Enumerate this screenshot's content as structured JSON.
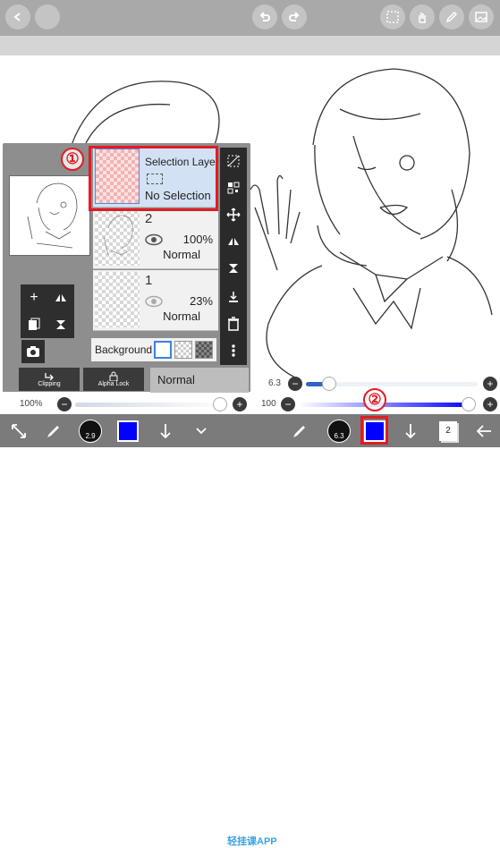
{
  "top_toolbar": {
    "left_icons": [
      "back-icon",
      "blank-icon"
    ],
    "right_icons": [
      "undo-icon",
      "redo-icon",
      "selection-icon",
      "hand-icon",
      "pen-icon",
      "image-icon"
    ]
  },
  "layer_panel": {
    "layers": [
      {
        "name": "Selection Layer",
        "status": "No Selection",
        "selected": true
      },
      {
        "number": "2",
        "opacity": "100%",
        "blend": "Normal",
        "visible": true
      },
      {
        "number": "1",
        "opacity": "23%",
        "blend": "Normal",
        "visible": false
      }
    ],
    "background_label": "Background",
    "clipping_label": "Clipping",
    "alpha_lock_label": "Alpha Lock",
    "blend_mode": "Normal",
    "side_tool_icons": [
      "select-all-icon",
      "qr-icon",
      "move-icon",
      "flip-icon",
      "transform-icon",
      "merge-down-icon",
      "trash-icon",
      "more-icon"
    ],
    "mini_tool_icons": [
      "add-layer-icon",
      "flip-layer-icon",
      "copy-layer-icon",
      "merge-icon",
      "camera-icon"
    ]
  },
  "sliders": {
    "left_opacity": {
      "label": "100%",
      "fraction": 1.0
    },
    "brush_size": {
      "label": "6.3",
      "fraction": 0.1
    },
    "brush_opacity": {
      "label": "100",
      "fraction": 1.0
    }
  },
  "annotations": {
    "one": "①",
    "two": "②"
  },
  "bottom_toolbar": {
    "left_brush_size": "2.9",
    "right_brush_size": "6.3",
    "layer_count": "2",
    "watermark": "轻挂课APP",
    "color": "#0000ff"
  },
  "colors": {
    "highlight": "#e31b23",
    "accent": "#0000ff",
    "topbar": "#a9a9a9"
  }
}
